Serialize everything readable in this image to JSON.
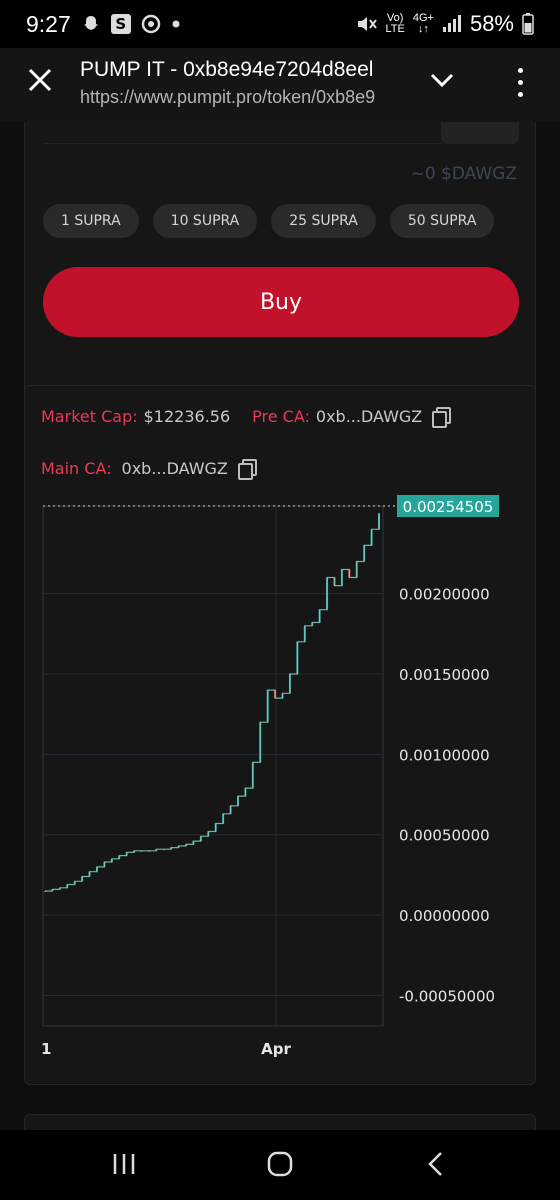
{
  "status_bar": {
    "time": "9:27",
    "left_icons": [
      "snapchat-icon",
      "s-app-icon",
      "chrome-icon",
      "dot-icon"
    ],
    "network_top": "Vo)",
    "network_bottom": "LTE",
    "net2_top": "4G+",
    "net2_bottom": "↓↑",
    "battery": "58%"
  },
  "browser": {
    "title": "PUMP IT - 0xb8e94e7204d8eel",
    "url": "https://www.pumpit.pro/token/0xb8e9"
  },
  "buy_panel": {
    "estimate": "~0 $DAWGZ",
    "presets": [
      "1 SUPRA",
      "10 SUPRA",
      "25 SUPRA",
      "50 SUPRA"
    ],
    "buy_label": "Buy",
    "buy_color": "#c2122b"
  },
  "token_info": {
    "market_cap_label": "Market Cap:",
    "market_cap_value": "$12236.56",
    "pre_ca_label": "Pre CA:",
    "pre_ca_value": "0xb...DAWGZ",
    "main_ca_label": "Main CA:",
    "main_ca_value": "0xb...DAWGZ"
  },
  "chart_data": {
    "type": "candlestick",
    "title": "",
    "xlabel": "",
    "ylabel": "",
    "x_tick_labels": [
      "1",
      "Apr"
    ],
    "y_tick_labels": [
      "0.00200000",
      "0.00150000",
      "0.00100000",
      "0.00050000",
      "0.00000000",
      "-0.00050000"
    ],
    "y_ticks": [
      0.002,
      0.0015,
      0.001,
      0.0005,
      0.0,
      -0.0005
    ],
    "ylim": [
      -0.00069,
      0.00254505
    ],
    "last_price": 0.00254505,
    "last_price_label": "0.00254505",
    "last_price_color": "#26a69a",
    "up_color": "#26a69a",
    "down_color": "#ef5350",
    "grid": true,
    "series": [
      {
        "values": [
          0.00015,
          0.00016,
          0.00017,
          0.00019,
          0.00021,
          0.00024,
          0.00027,
          0.0003,
          0.00033,
          0.00035,
          0.00037,
          0.00039,
          0.0004,
          0.0004,
          0.0004,
          0.00041,
          0.00041,
          0.00042,
          0.00043,
          0.00044,
          0.00046,
          0.00049,
          0.00052,
          0.00057,
          0.00063,
          0.00068,
          0.00074,
          0.00079,
          0.00095,
          0.0012,
          0.0014,
          0.00135,
          0.00138,
          0.0015,
          0.0017,
          0.0018,
          0.00182,
          0.0019,
          0.0021,
          0.00205,
          0.00215,
          0.0021,
          0.0022,
          0.0023,
          0.0024,
          0.0025
        ]
      }
    ]
  }
}
